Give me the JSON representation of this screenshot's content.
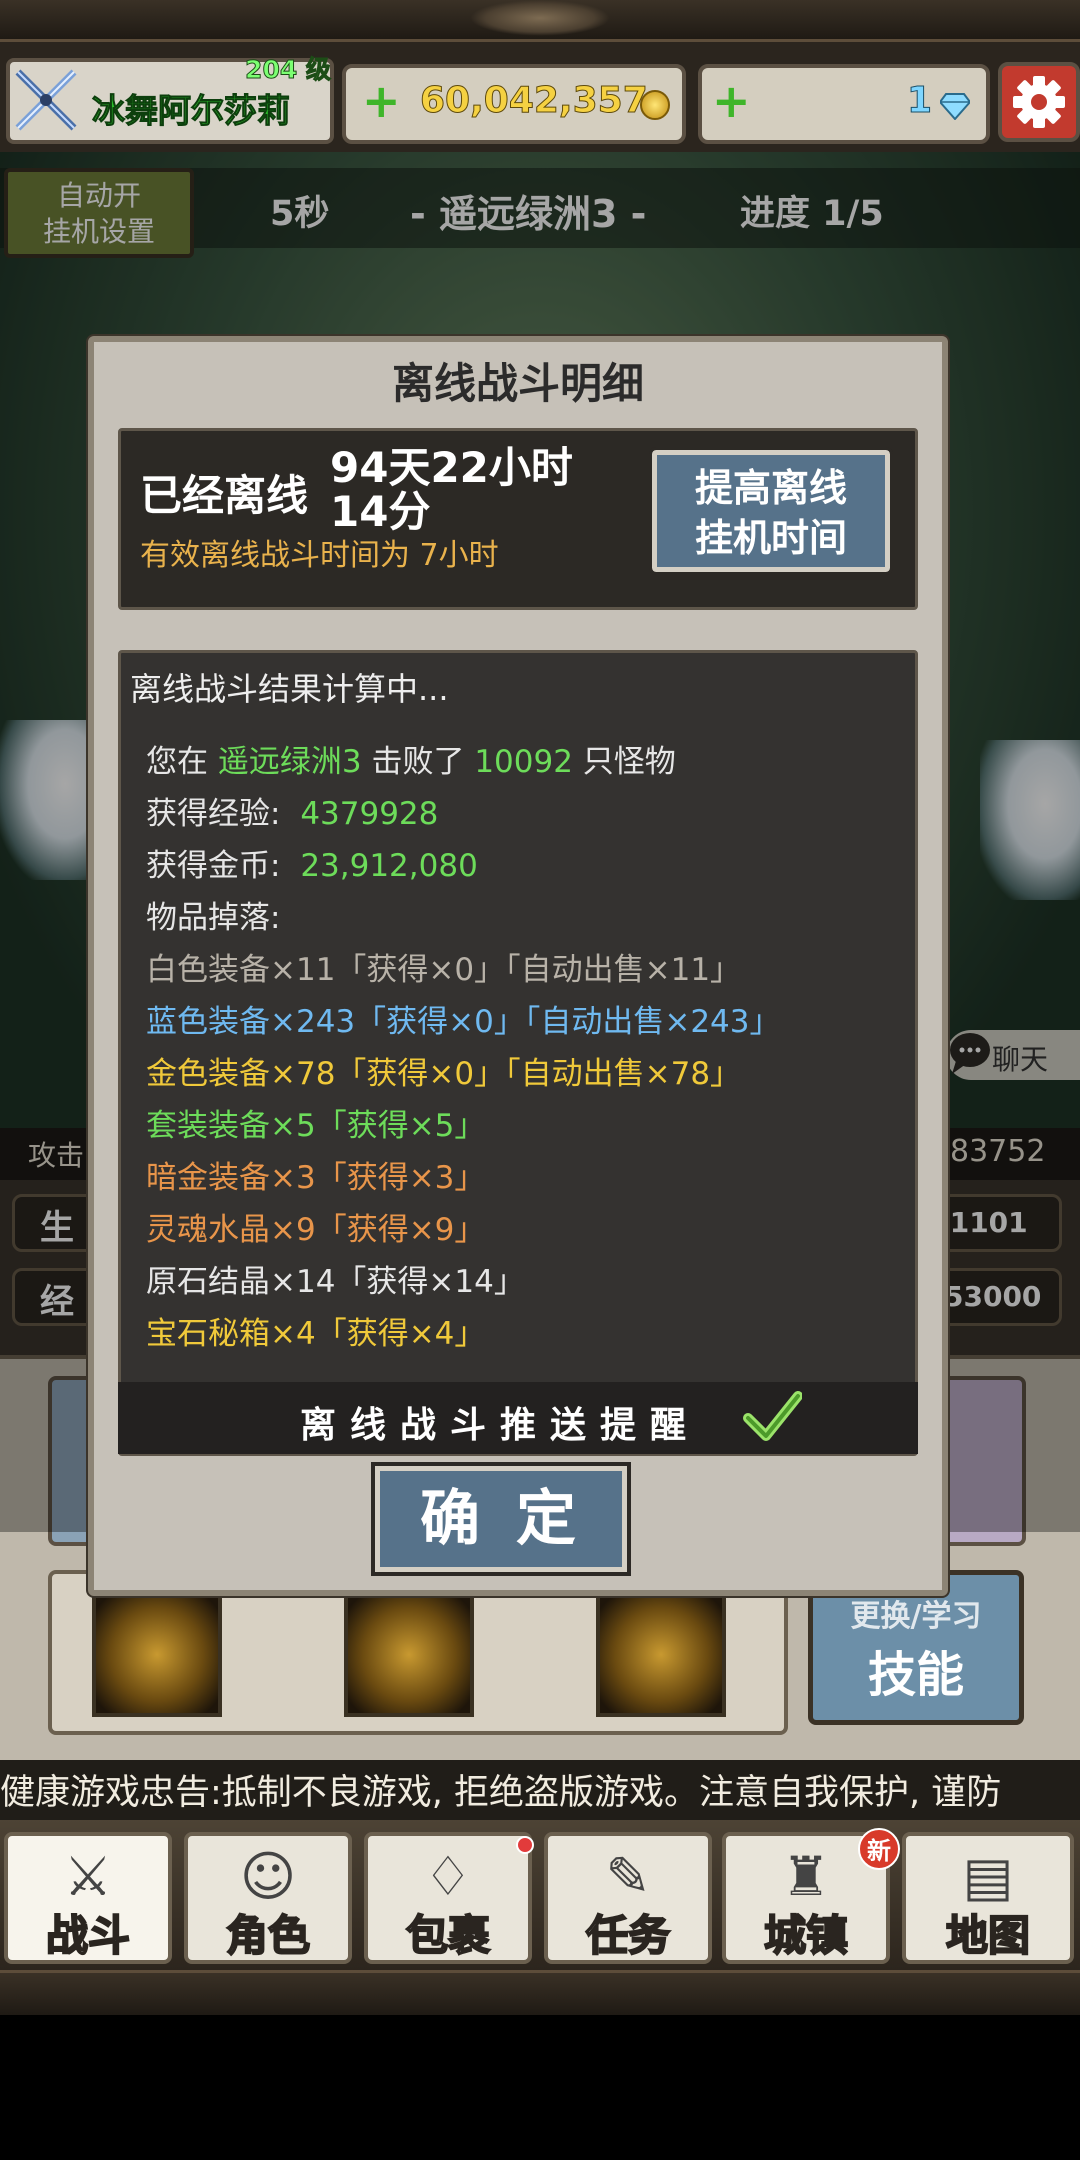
{
  "player": {
    "name": "冰舞阿尔莎莉",
    "level": "204 级"
  },
  "currency": {
    "gold": "60,042,357",
    "gems": "1"
  },
  "stage": {
    "timer": "5秒",
    "name": "-  遥远绿洲3  -",
    "progress": "进度 1/5"
  },
  "auto": {
    "line1": "自动开",
    "line2": "挂机设置"
  },
  "chat": {
    "label": "聊天"
  },
  "stats": {
    "attack_label": "攻击",
    "attack_value": "83752",
    "hp_label": "生",
    "hp_value": "5/1101",
    "exp_label": "经",
    "exp_value": "53000"
  },
  "skills": {
    "button_top": "更换/学习",
    "button_main": "技能"
  },
  "notice": "健康游戏忠告:抵制不良游戏, 拒绝盗版游戏。注意自我保护, 谨防",
  "nav": [
    {
      "label": "战斗",
      "icon": "sword-icon"
    },
    {
      "label": "角色",
      "icon": "character-icon"
    },
    {
      "label": "包裹",
      "icon": "bag-icon"
    },
    {
      "label": "任务",
      "icon": "quest-icon"
    },
    {
      "label": "城镇",
      "icon": "town-icon",
      "badge": "新"
    },
    {
      "label": "地图",
      "icon": "map-icon"
    }
  ],
  "dialog": {
    "title": "离线战斗明细",
    "offline_label": "已经离线",
    "offline_time": "94天22小时14分",
    "effective_note": "有效离线战斗时间为 7小时",
    "raise_button_line1": "提高离线",
    "raise_button_line2": "挂机时间",
    "calculating": "离线战斗结果计算中...",
    "defeat_prefix": "您在",
    "defeat_place": "遥远绿洲3",
    "defeat_mid": "击败了",
    "defeat_count": "10092",
    "defeat_suffix": "只怪物",
    "exp_label": "获得经验:",
    "exp_value": "4379928",
    "gold_label": "获得金币:",
    "gold_value": "23,912,080",
    "drops_label": "物品掉落:",
    "drops": [
      "白色装备×11「获得×0」「自动出售×11」",
      "蓝色装备×243「获得×0」「自动出售×243」",
      "金色装备×78「获得×0」「自动出售×78」",
      "套装装备×5「获得×5」",
      "暗金装备×3「获得×3」",
      "灵魂水晶×9「获得×9」",
      "原石结晶×14「获得×14」",
      "宝石秘箱×4「获得×4」"
    ],
    "push_reminder": "离线战斗推送提醒",
    "push_enabled": true,
    "confirm": "确定"
  },
  "colors": {
    "accent_blue": "#56728a",
    "green_text": "#6ddc5a",
    "gold_text": "#f0c93a"
  }
}
